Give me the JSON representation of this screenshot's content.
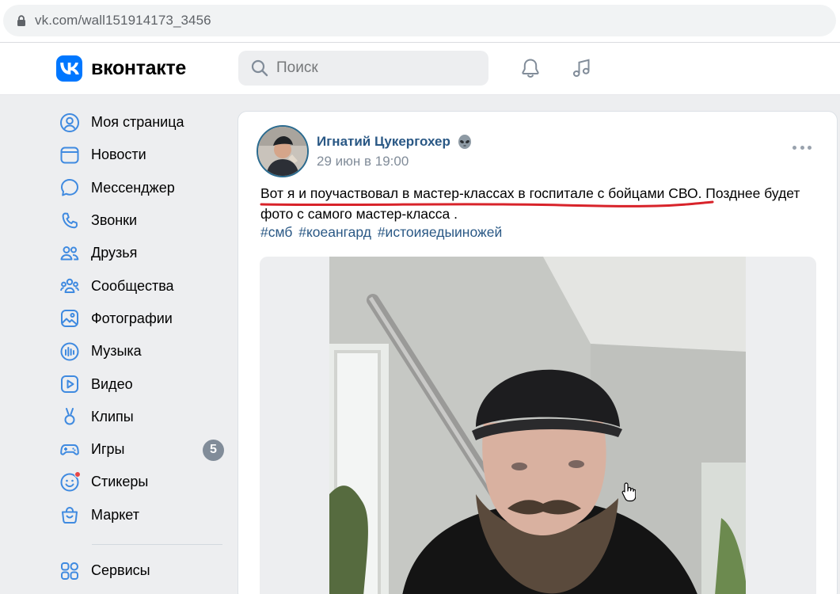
{
  "browser": {
    "url": "vk.com/wall151914173_3456"
  },
  "header": {
    "logo_text": "вконтакте",
    "search_placeholder": "Поиск",
    "icons": [
      "bell-icon",
      "music-icon"
    ]
  },
  "sidebar": {
    "items": [
      {
        "label": "Моя страница",
        "icon": "user-circle-icon"
      },
      {
        "label": "Новости",
        "icon": "news-icon"
      },
      {
        "label": "Мессенджер",
        "icon": "message-icon"
      },
      {
        "label": "Звонки",
        "icon": "phone-icon"
      },
      {
        "label": "Друзья",
        "icon": "friends-icon"
      },
      {
        "label": "Сообщества",
        "icon": "communities-icon"
      },
      {
        "label": "Фотографии",
        "icon": "photos-icon"
      },
      {
        "label": "Музыка",
        "icon": "music-bars-icon"
      },
      {
        "label": "Видео",
        "icon": "video-icon"
      },
      {
        "label": "Клипы",
        "icon": "clips-icon"
      },
      {
        "label": "Игры",
        "icon": "gamepad-icon",
        "badge": "5"
      },
      {
        "label": "Стикеры",
        "icon": "sticker-icon"
      },
      {
        "label": "Маркет",
        "icon": "market-bag-icon"
      }
    ],
    "services": {
      "label": "Сервисы",
      "icon": "services-grid-icon"
    }
  },
  "post": {
    "author": "Игнатий Цукергохер",
    "author_emoji": "alien-icon",
    "date": "29 июн в 19:00",
    "text_highlight": "Вот я и поучаствовал в мастер-классах в госпитале с бойцами СВО",
    "text_rest": ". Позднее будет фото с самого мастер-класса .",
    "hashtags": [
      "#смб",
      "#коеангард",
      "#истоияедыиножей"
    ]
  },
  "colors": {
    "accent": "#0077ff",
    "link": "#2a5885",
    "secondary_text": "#818c99",
    "background": "#edeef0",
    "underline_annotation": "#d8232a"
  }
}
